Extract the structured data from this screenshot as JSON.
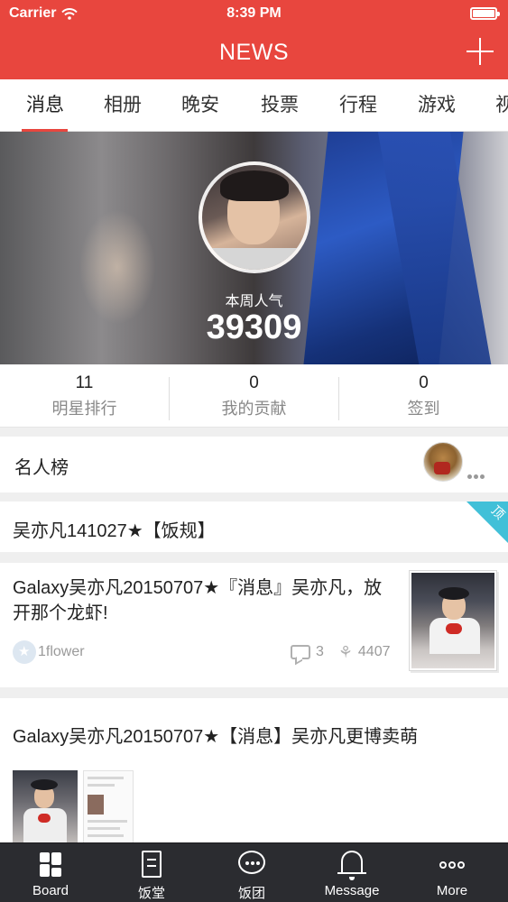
{
  "status_bar": {
    "carrier": "Carrier",
    "time": "8:39 PM"
  },
  "nav": {
    "title": "NEWS",
    "add_icon": "plus-icon"
  },
  "tabs": [
    {
      "label": "消息",
      "active": true
    },
    {
      "label": "相册"
    },
    {
      "label": "晚安"
    },
    {
      "label": "投票"
    },
    {
      "label": "行程"
    },
    {
      "label": "游戏"
    },
    {
      "label": "视"
    }
  ],
  "hero": {
    "label": "本周人气",
    "value": "39309"
  },
  "stats": [
    {
      "value": "11",
      "label": "明星排行"
    },
    {
      "value": "0",
      "label": "我的贡献"
    },
    {
      "value": "0",
      "label": "签到"
    }
  ],
  "celebrity": {
    "title": "名人榜"
  },
  "pinned_post": {
    "title": "吴亦凡141027★【饭规】",
    "badge": "顶"
  },
  "post1": {
    "title": "Galaxy吴亦凡20150707★『消息』吴亦凡，放开那个龙虾!",
    "author": "1flower",
    "comments": "3",
    "flowers": "4407"
  },
  "post2": {
    "title": "Galaxy吴亦凡20150707★【消息】吴亦凡更博卖萌"
  },
  "tabbar": [
    {
      "label": "Board",
      "icon": "grid-icon"
    },
    {
      "label": "饭堂",
      "icon": "document-icon"
    },
    {
      "label": "饭团",
      "icon": "chat-bubble-icon"
    },
    {
      "label": "Message",
      "icon": "bell-icon"
    },
    {
      "label": "More",
      "icon": "more-dots-icon"
    }
  ],
  "colors": {
    "accent": "#e8463e",
    "pin": "#41c0d8",
    "tabbar_bg": "#2b2c30"
  }
}
